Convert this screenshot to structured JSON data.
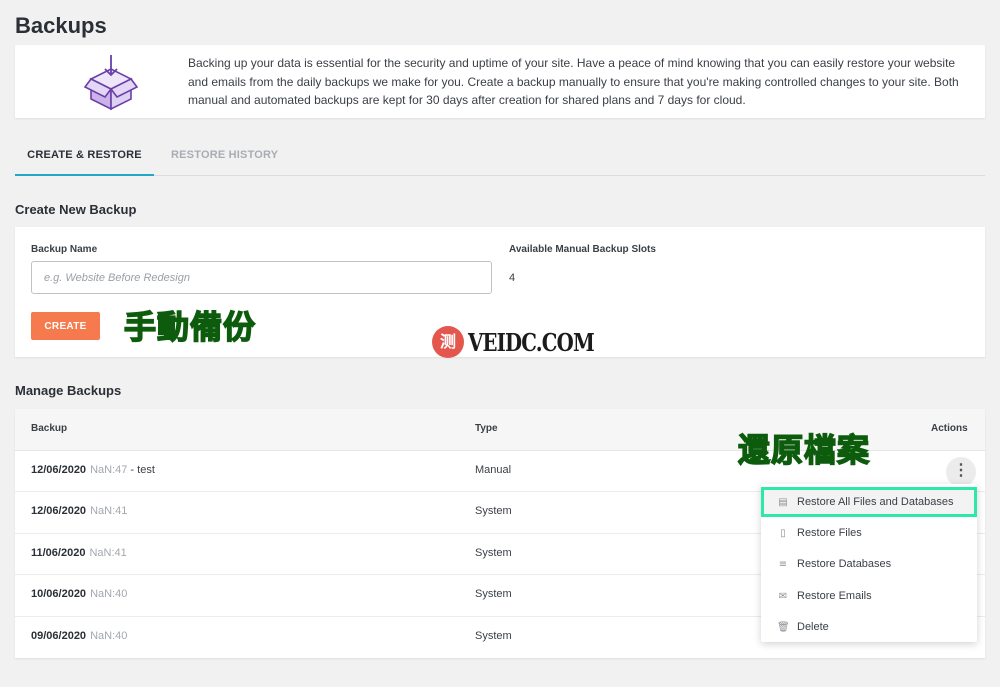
{
  "page": {
    "title": "Backups"
  },
  "info": {
    "text": "Backing up your data is essential for the security and uptime of your site. Have a peace of mind knowing that you can easily restore your website and emails from the daily backups we make for you. Create a backup manually to ensure that you're making controlled changes to your site. Both manual and automated backups are kept for 30 days after creation for shared plans and 7 days for cloud."
  },
  "tabs": [
    {
      "label": "CREATE & RESTORE",
      "active": true
    },
    {
      "label": "RESTORE HISTORY",
      "active": false
    }
  ],
  "create": {
    "section_title": "Create New Backup",
    "name_label": "Backup Name",
    "name_placeholder": "e.g. Website Before Redesign",
    "slots_label": "Available Manual Backup Slots",
    "slots_value": "4",
    "button_label": "CREATE"
  },
  "annotations": {
    "manual_backup": "手動備份",
    "restore_files": "還原檔案",
    "watermark_badge": "测",
    "watermark_text": "VEIDC.COM"
  },
  "manage": {
    "section_title": "Manage Backups",
    "columns": {
      "backup": "Backup",
      "type": "Type",
      "actions": "Actions"
    },
    "rows": [
      {
        "date": "12/06/2020",
        "time": "NaN:47",
        "note": "- test",
        "type": "Manual"
      },
      {
        "date": "12/06/2020",
        "time": "NaN:41",
        "note": "",
        "type": "System"
      },
      {
        "date": "11/06/2020",
        "time": "NaN:41",
        "note": "",
        "type": "System"
      },
      {
        "date": "10/06/2020",
        "time": "NaN:40",
        "note": "",
        "type": "System"
      },
      {
        "date": "09/06/2020",
        "time": "NaN:40",
        "note": "",
        "type": "System"
      }
    ],
    "actions_menu": [
      {
        "label": "Restore All Files and Databases",
        "icon": "server-icon"
      },
      {
        "label": "Restore Files",
        "icon": "file-icon"
      },
      {
        "label": "Restore Databases",
        "icon": "database-icon"
      },
      {
        "label": "Restore Emails",
        "icon": "envelope-icon"
      },
      {
        "label": "Delete",
        "icon": "trash-icon"
      }
    ]
  },
  "colors": {
    "accent_tab": "#22a8c4",
    "create_button": "#f57a4e",
    "annotation_green": "#2fdc2a",
    "highlight_border": "#2ee8a8"
  }
}
